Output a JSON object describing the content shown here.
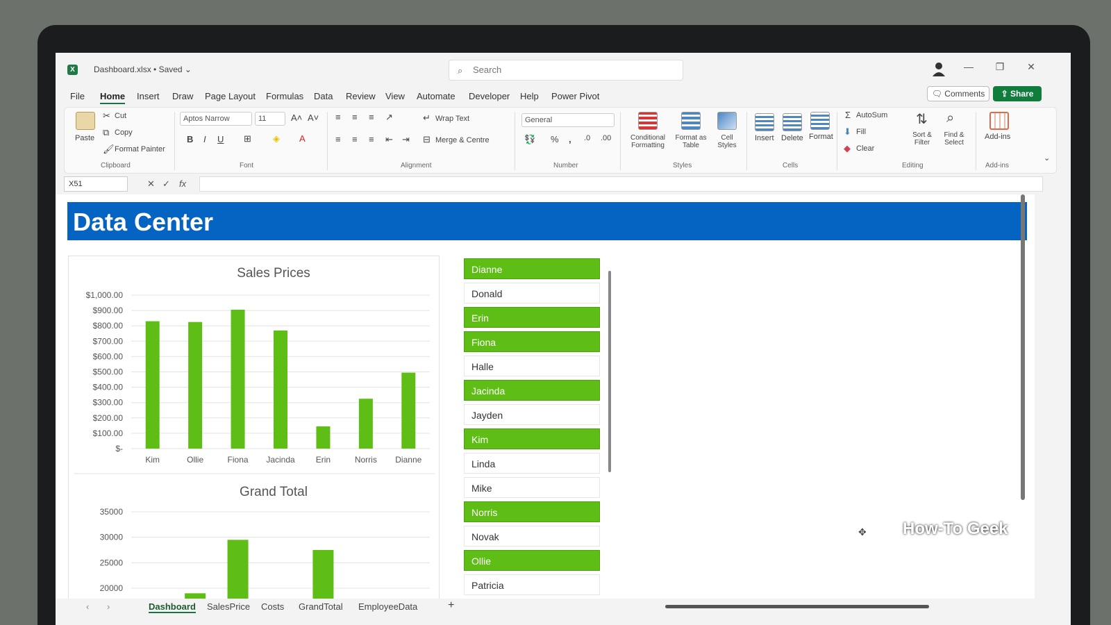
{
  "window": {
    "doc_title": "Dashboard.xlsx • Saved ⌄",
    "search_placeholder": "Search"
  },
  "menu": {
    "items": [
      "File",
      "Home",
      "Insert",
      "Draw",
      "Page Layout",
      "Formulas",
      "Data",
      "Review",
      "View",
      "Automate",
      "Developer",
      "Help",
      "Power Pivot"
    ],
    "active": "Home",
    "comments": "Comments",
    "share": "Share"
  },
  "ribbon": {
    "clipboard": {
      "paste": "Paste",
      "cut": "Cut",
      "copy": "Copy",
      "format_painter": "Format Painter",
      "label": "Clipboard"
    },
    "font": {
      "name": "Aptos Narrow",
      "size": "11",
      "label": "Font"
    },
    "alignment": {
      "wrap_text": "Wrap Text",
      "merge": "Merge & Centre",
      "label": "Alignment"
    },
    "number": {
      "format": "General",
      "label": "Number"
    },
    "styles": {
      "conditional": "Conditional Formatting",
      "format_table": "Format as Table",
      "cell_styles": "Cell Styles",
      "label": "Styles"
    },
    "cells": {
      "insert": "Insert",
      "delete": "Delete",
      "format": "Format",
      "label": "Cells"
    },
    "editing": {
      "autosum": "AutoSum",
      "fill": "Fill",
      "clear": "Clear",
      "sort": "Sort & Filter",
      "find": "Find & Select",
      "label": "Editing"
    },
    "addins": {
      "addins": "Add-ins",
      "label": "Add-ins"
    }
  },
  "formula_bar": {
    "cell_ref": "X51",
    "fx": "fx"
  },
  "dashboard": {
    "title": "Data Center"
  },
  "chart_data": [
    {
      "type": "bar",
      "title": "Sales Prices",
      "categories": [
        "Kim",
        "Ollie",
        "Fiona",
        "Jacinda",
        "Erin",
        "Norris",
        "Dianne"
      ],
      "values": [
        830,
        825,
        905,
        770,
        145,
        325,
        495
      ],
      "ylim": [
        0,
        1000
      ],
      "yticks": [
        "$-",
        "$100.00",
        "$200.00",
        "$300.00",
        "$400.00",
        "$500.00",
        "$600.00",
        "$700.00",
        "$800.00",
        "$900.00",
        "$1,000.00"
      ],
      "color": "#5fbe16"
    },
    {
      "type": "bar",
      "title": "Grand Total",
      "categories": [
        "",
        "",
        "",
        "",
        "",
        "",
        ""
      ],
      "values": [
        null,
        19000,
        29500,
        null,
        27500,
        null,
        null
      ],
      "ylim": [
        17000,
        35000
      ],
      "yticks": [
        "20000",
        "25000",
        "30000",
        "35000"
      ],
      "color": "#5fbe16"
    }
  ],
  "slicer": {
    "items": [
      {
        "name": "Dianne",
        "selected": true
      },
      {
        "name": "Donald",
        "selected": false
      },
      {
        "name": "Erin",
        "selected": true
      },
      {
        "name": "Fiona",
        "selected": true
      },
      {
        "name": "Halle",
        "selected": false
      },
      {
        "name": "Jacinda",
        "selected": true
      },
      {
        "name": "Jayden",
        "selected": false
      },
      {
        "name": "Kim",
        "selected": true
      },
      {
        "name": "Linda",
        "selected": false
      },
      {
        "name": "Mike",
        "selected": false
      },
      {
        "name": "Norris",
        "selected": true
      },
      {
        "name": "Novak",
        "selected": false
      },
      {
        "name": "Ollie",
        "selected": true
      },
      {
        "name": "Patricia",
        "selected": false
      }
    ]
  },
  "tabs": {
    "items": [
      "Dashboard",
      "SalesPrice",
      "Costs",
      "GrandTotal",
      "EmployeeData"
    ],
    "active": "Dashboard",
    "add": "+"
  },
  "watermark": "How-To Geek"
}
